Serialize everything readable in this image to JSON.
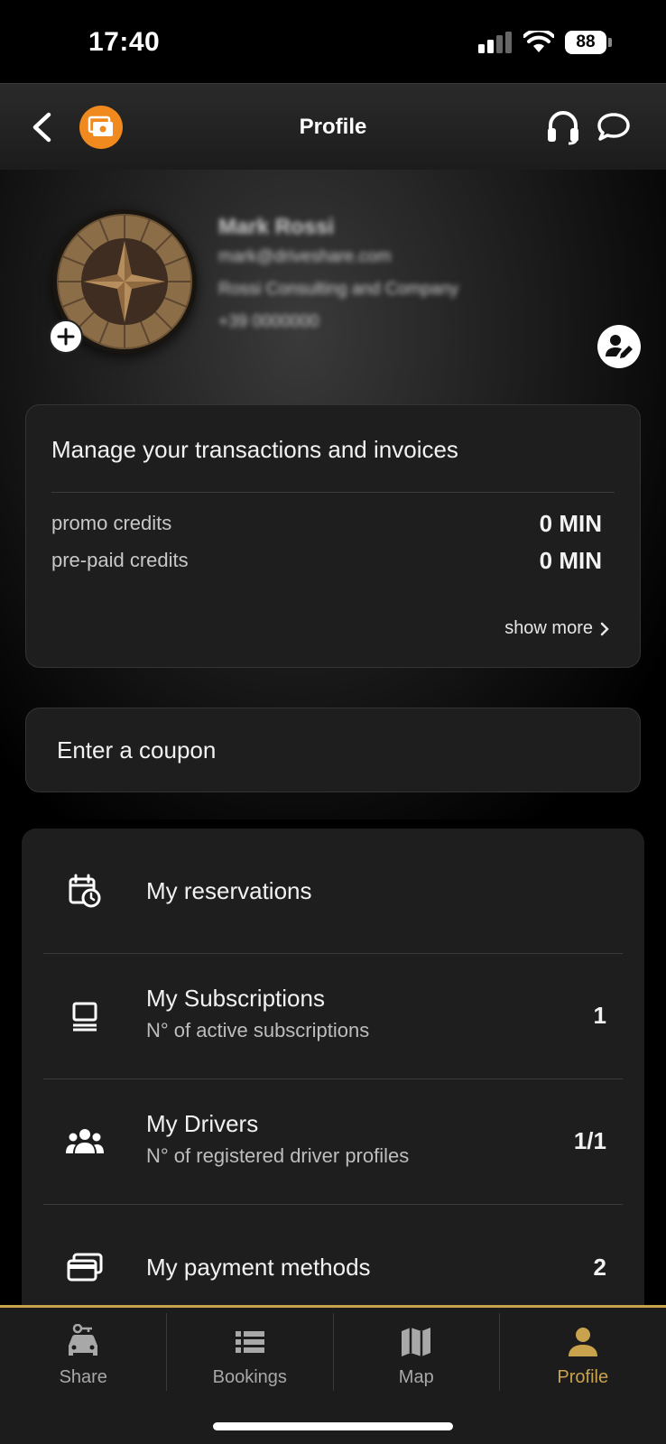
{
  "status_bar": {
    "time": "17:40",
    "battery": "88"
  },
  "header": {
    "title": "Profile"
  },
  "profile": {
    "name": "Mark Rossi",
    "email": "mark@driveshare.com",
    "company": "Rossi Consulting and Company",
    "phone": "+39 0000000"
  },
  "credits": {
    "title": "Manage your transactions and invoices",
    "promo_label": "promo credits",
    "promo_value": "0 MIN",
    "prepaid_label": "pre-paid credits",
    "prepaid_value": "0 MIN",
    "show_more": "show more"
  },
  "coupon": {
    "label": "Enter a coupon"
  },
  "menu": {
    "reservations": {
      "title": "My reservations"
    },
    "subscriptions": {
      "title": "My Subscriptions",
      "subtitle": "N° of active subscriptions",
      "count": "1"
    },
    "drivers": {
      "title": "My Drivers",
      "subtitle": "N° of registered driver profiles",
      "count": "1/1"
    },
    "payments": {
      "title": "My payment methods",
      "count": "2"
    }
  },
  "tabs": [
    {
      "label": "Share",
      "icon": "car-key-icon"
    },
    {
      "label": "Bookings",
      "icon": "list-icon"
    },
    {
      "label": "Map",
      "icon": "map-icon"
    },
    {
      "label": "Profile",
      "icon": "person-icon"
    }
  ],
  "colors": {
    "accent": "#c9a24d",
    "wallet": "#f08a1e",
    "background": "#000000",
    "card": "#1e1e1e"
  }
}
